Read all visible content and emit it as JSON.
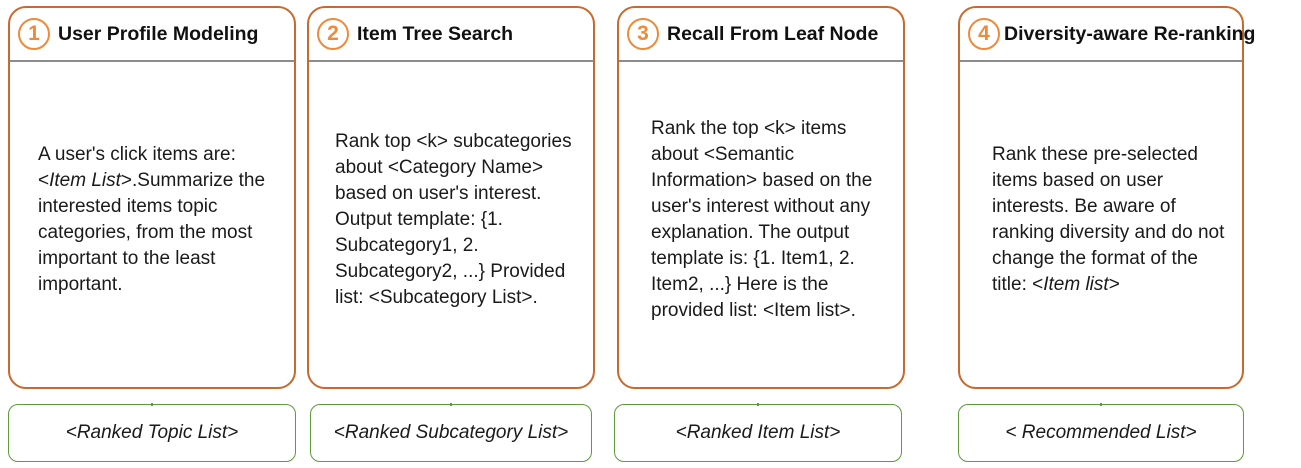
{
  "steps": [
    {
      "number": "1",
      "title": "User Profile Modeling",
      "prompt": {
        "pre": "A user's click items are: <",
        "italic": "Item List",
        "post": ">.Summarize the interested items topic categories, from the most important to the least important."
      },
      "output": "<Ranked Topic List>"
    },
    {
      "number": "2",
      "title": "Item Tree Search",
      "prompt": {
        "pre": "Rank top <k> subcategories about <Category Name> based on user's interest. Output template: {1. Subcategory1, 2. Subcategory2, ...} Provided list: <Subcategory List>.",
        "italic": "",
        "post": ""
      },
      "output": "<Ranked Subcategory List>"
    },
    {
      "number": "3",
      "title": "Recall From Leaf Node",
      "prompt": {
        "pre": "Rank the top <k> items about <Semantic Information> based on the user's interest without any explanation. The output template is: {1. Item1, 2. Item2, ...} Here is the provided list: <Item list>.",
        "italic": "",
        "post": ""
      },
      "output": "<Ranked Item List>"
    },
    {
      "number": "4",
      "title": "Diversity-aware Re-ranking",
      "prompt": {
        "pre": "Rank these pre-selected items based on user interests. Be aware of ranking diversity and do not change the format of the title: <",
        "italic": "Item list",
        "post": ">"
      },
      "output": "< Recommended List>"
    }
  ],
  "colors": {
    "card_border": "#c8692d",
    "badge": "#ee8a3a",
    "divider": "#8c8c8c",
    "output_border": "#5e9b3c"
  }
}
